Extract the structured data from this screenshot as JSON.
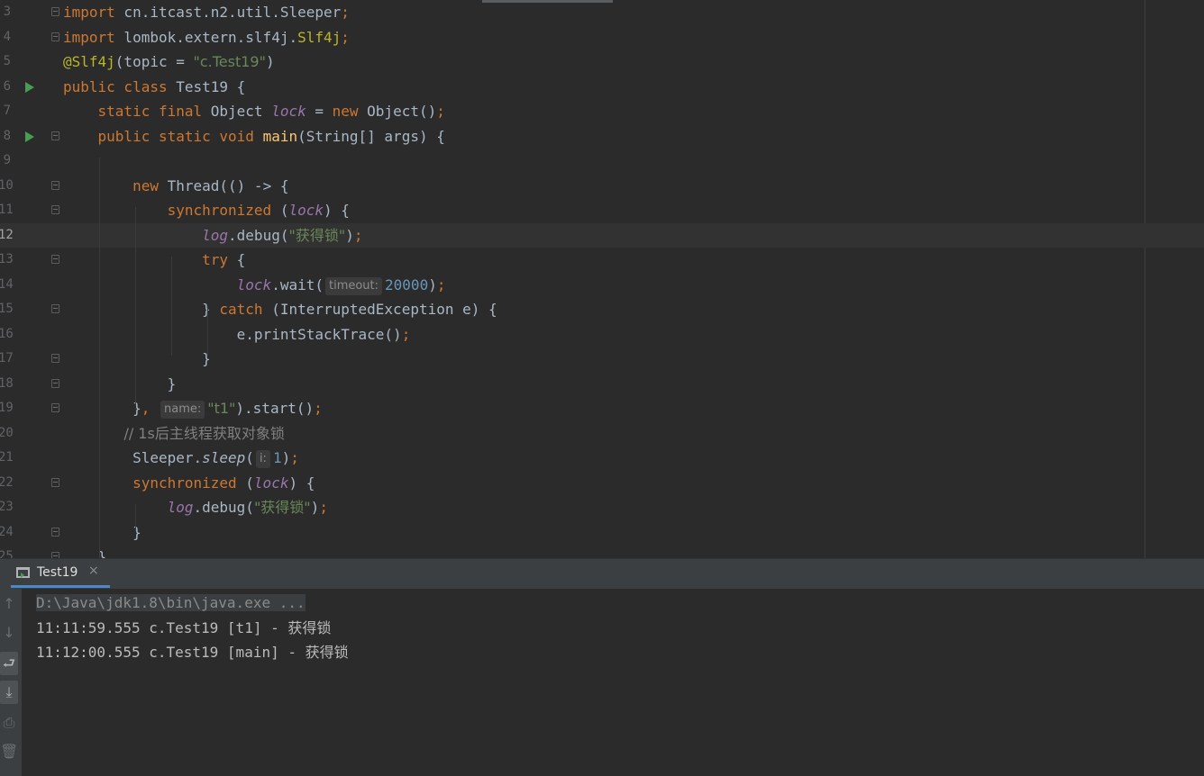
{
  "editor": {
    "lines": [
      {
        "num": "3",
        "tokens": [
          {
            "k": "kw",
            "t": "import"
          },
          {
            "k": "",
            "t": " cn.itcast.n2.util.Sleeper"
          },
          {
            "k": "kw",
            "t": ";"
          }
        ]
      },
      {
        "num": "4",
        "tokens": [
          {
            "k": "kw",
            "t": "import"
          },
          {
            "k": "",
            "t": " lombok.extern.slf4j."
          },
          {
            "k": "an",
            "t": "Slf4j"
          },
          {
            "k": "kw",
            "t": ";"
          }
        ]
      },
      {
        "num": "5",
        "tokens": [
          {
            "k": "an",
            "t": "@Slf4j"
          },
          {
            "k": "",
            "t": "(topic = "
          },
          {
            "k": "st",
            "t": "\"c.Test19\""
          },
          {
            "k": "",
            "t": ")"
          }
        ]
      },
      {
        "num": "6",
        "tokens": [
          {
            "k": "kw",
            "t": "public class"
          },
          {
            "k": "",
            "t": " Test19 {"
          }
        ]
      },
      {
        "num": "7",
        "tokens": [
          {
            "k": "",
            "t": "    "
          },
          {
            "k": "kw",
            "t": "static final"
          },
          {
            "k": "",
            "t": " Object "
          },
          {
            "k": "fld",
            "t": "lock"
          },
          {
            "k": "",
            "t": " = "
          },
          {
            "k": "kw",
            "t": "new"
          },
          {
            "k": "",
            "t": " Object()"
          },
          {
            "k": "kw",
            "t": ";"
          }
        ]
      },
      {
        "num": "8",
        "tokens": [
          {
            "k": "",
            "t": "    "
          },
          {
            "k": "kw",
            "t": "public static void"
          },
          {
            "k": "",
            "t": " "
          },
          {
            "k": "fn",
            "t": "main"
          },
          {
            "k": "",
            "t": "(String[] args) {"
          }
        ]
      },
      {
        "num": "9",
        "tokens": []
      },
      {
        "num": "10",
        "tokens": [
          {
            "k": "",
            "t": "        "
          },
          {
            "k": "kw",
            "t": "new"
          },
          {
            "k": "",
            "t": " Thread(() -> {"
          }
        ]
      },
      {
        "num": "11",
        "tokens": [
          {
            "k": "",
            "t": "            "
          },
          {
            "k": "kw",
            "t": "synchronized"
          },
          {
            "k": "",
            "t": " ("
          },
          {
            "k": "fld",
            "t": "lock"
          },
          {
            "k": "",
            "t": ") {"
          }
        ]
      },
      {
        "num": "12",
        "tokens": [
          {
            "k": "",
            "t": "                "
          },
          {
            "k": "fld",
            "t": "log"
          },
          {
            "k": "",
            "t": ".debug("
          },
          {
            "k": "st",
            "t": "\"获得锁\""
          },
          {
            "k": "",
            "t": ")"
          },
          {
            "k": "kw",
            "t": ";"
          }
        ]
      },
      {
        "num": "13",
        "tokens": [
          {
            "k": "",
            "t": "                "
          },
          {
            "k": "kw",
            "t": "try"
          },
          {
            "k": "",
            "t": " {"
          }
        ]
      },
      {
        "num": "14",
        "tokens": [
          {
            "k": "",
            "t": "                    "
          },
          {
            "k": "fld",
            "t": "lock"
          },
          {
            "k": "",
            "t": ".wait("
          },
          {
            "k": "hint",
            "t": "timeout:"
          },
          {
            "k": "nu",
            "t": "20000"
          },
          {
            "k": "",
            "t": ")"
          },
          {
            "k": "kw",
            "t": ";"
          }
        ]
      },
      {
        "num": "15",
        "tokens": [
          {
            "k": "",
            "t": "                } "
          },
          {
            "k": "kw",
            "t": "catch"
          },
          {
            "k": "",
            "t": " (InterruptedException e) {"
          }
        ]
      },
      {
        "num": "16",
        "tokens": [
          {
            "k": "",
            "t": "                    e.printStackTrace()"
          },
          {
            "k": "kw",
            "t": ";"
          }
        ]
      },
      {
        "num": "17",
        "tokens": [
          {
            "k": "",
            "t": "                }"
          }
        ]
      },
      {
        "num": "18",
        "tokens": [
          {
            "k": "",
            "t": "            }"
          }
        ]
      },
      {
        "num": "19",
        "tokens": [
          {
            "k": "",
            "t": "        }"
          },
          {
            "k": "kw",
            "t": ","
          },
          {
            "k": "",
            "t": " "
          },
          {
            "k": "hint",
            "t": "name:"
          },
          {
            "k": "st",
            "t": "\"t1\""
          },
          {
            "k": "",
            "t": ").start()"
          },
          {
            "k": "kw",
            "t": ";"
          }
        ]
      },
      {
        "num": "20",
        "tokens": [
          {
            "k": "",
            "t": "       "
          },
          {
            "k": "cm",
            "t": "// 1s后主线程获取对象锁"
          }
        ]
      },
      {
        "num": "21",
        "tokens": [
          {
            "k": "",
            "t": "        Sleeper."
          },
          {
            "k": "fsi",
            "t": "sleep"
          },
          {
            "k": "",
            "t": "("
          },
          {
            "k": "hint",
            "t": "i:"
          },
          {
            "k": "nu",
            "t": "1"
          },
          {
            "k": "",
            "t": ")"
          },
          {
            "k": "kw",
            "t": ";"
          }
        ]
      },
      {
        "num": "22",
        "tokens": [
          {
            "k": "",
            "t": "        "
          },
          {
            "k": "kw",
            "t": "synchronized"
          },
          {
            "k": "",
            "t": " ("
          },
          {
            "k": "fld",
            "t": "lock"
          },
          {
            "k": "",
            "t": ") {"
          }
        ]
      },
      {
        "num": "23",
        "tokens": [
          {
            "k": "",
            "t": "            "
          },
          {
            "k": "fld",
            "t": "log"
          },
          {
            "k": "",
            "t": ".debug("
          },
          {
            "k": "st",
            "t": "\"获得锁\""
          },
          {
            "k": "",
            "t": ")"
          },
          {
            "k": "kw",
            "t": ";"
          }
        ]
      },
      {
        "num": "24",
        "tokens": [
          {
            "k": "",
            "t": "        }"
          }
        ]
      },
      {
        "num": "25",
        "tokens": [
          {
            "k": "",
            "t": "    }"
          }
        ]
      }
    ],
    "current_line": "12",
    "run_lines": [
      "6",
      "8"
    ]
  },
  "run_panel": {
    "tab_label": "Test19",
    "tab_close": "×",
    "console_lines": [
      {
        "text": "D:\\Java\\jdk1.8\\bin\\java.exe ...",
        "kind": "cmd"
      },
      {
        "text": "11:11:59.555 c.Test19 [t1] - 获得锁",
        "kind": "out"
      },
      {
        "text": "11:12:00.555 c.Test19 [main] - 获得锁",
        "kind": "out"
      }
    ],
    "tools": [
      {
        "name": "up-arrow-icon",
        "glyph": "↑",
        "active": false
      },
      {
        "name": "down-arrow-icon",
        "glyph": "↓",
        "active": false
      },
      {
        "name": "soft-wrap-icon",
        "glyph": "⮐",
        "active": true
      },
      {
        "name": "scroll-to-end-icon",
        "glyph": "⤓",
        "active": true
      },
      {
        "name": "print-icon",
        "glyph": "⎙",
        "active": false
      },
      {
        "name": "trash-icon",
        "glyph": "🗑",
        "active": false
      }
    ]
  }
}
